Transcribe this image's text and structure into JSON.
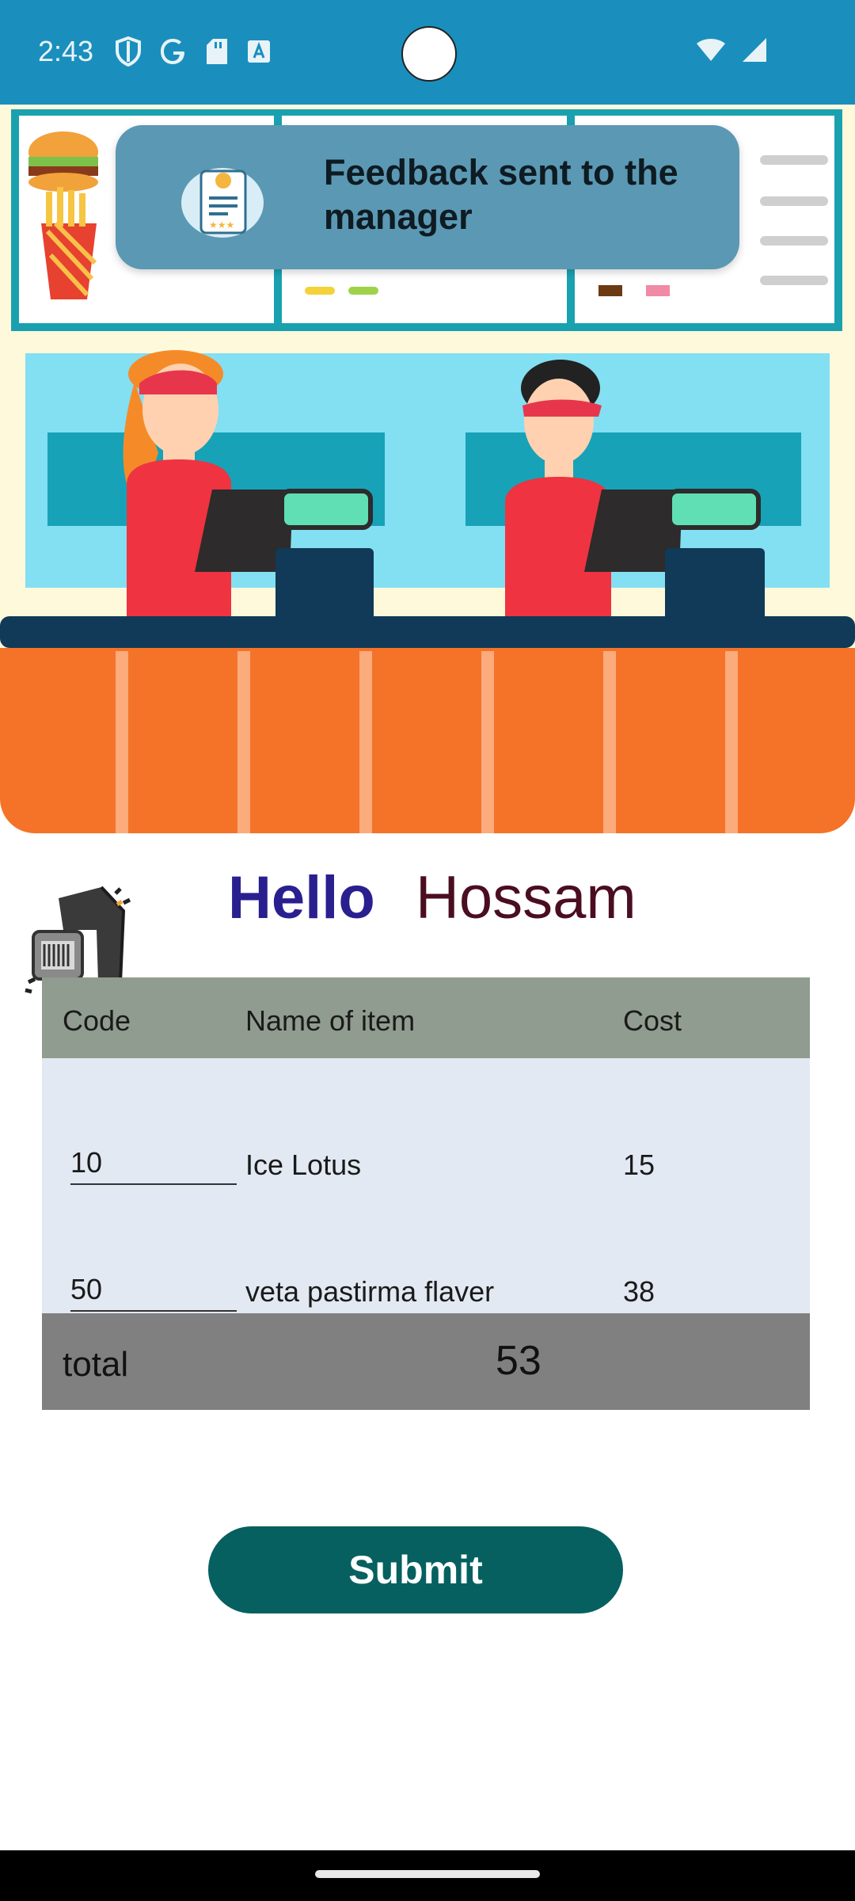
{
  "status_bar": {
    "time": "2:43",
    "left_icons": [
      "shield-icon",
      "google-icon",
      "sd-card-icon",
      "font-download-icon"
    ],
    "right_icons": [
      "wifi-icon",
      "cellular-signal-icon"
    ]
  },
  "toast": {
    "message": "Feedback sent to the manager",
    "icon": "feedback-form-icon"
  },
  "greeting": {
    "hello": "Hello",
    "name": "Hossam"
  },
  "table": {
    "headers": {
      "code": "Code",
      "name": "Name of item",
      "cost": "Cost"
    },
    "rows": [
      {
        "code": "10",
        "name": "Ice Lotus",
        "cost": "15"
      },
      {
        "code": "50",
        "name": "veta pastirma flaver",
        "cost": "38"
      }
    ],
    "total_label": "total",
    "total_value": "53"
  },
  "actions": {
    "submit_label": "Submit"
  },
  "colors": {
    "status_bar": "#1a8fbd",
    "toast_bg": "#5b98b3",
    "hello_color": "#2a1f8f",
    "name_color": "#4a0e20",
    "header_bg": "#909c8f",
    "rows_bg": "#e3e9f2",
    "footer_bg": "#808080",
    "submit_bg": "#066060"
  }
}
